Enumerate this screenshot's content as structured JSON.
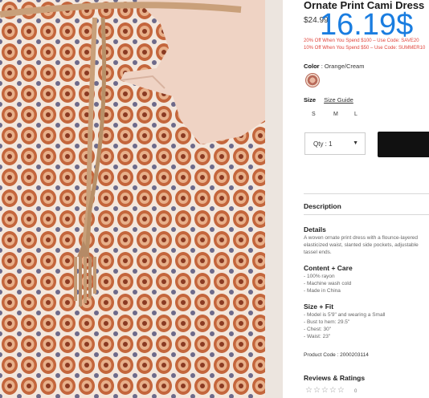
{
  "product": {
    "title": "Ornate Print Cami Dress",
    "price": "$24.99",
    "sale_price_overlay": "16.19$",
    "promo_1": "20% Off When You Spend $100 – Use Code: SAVE20",
    "promo_2": "10% Off When You Spend $50 – Use Code: SUMMER10",
    "color_label": "Color",
    "color_value": ": Orange/Cream",
    "size_label": "Size",
    "size_guide": "Size Guide",
    "sizes": [
      "S",
      "M",
      "L"
    ],
    "qty_label": "Qty : 1",
    "qty_caret": "▼",
    "description_heading": "Description",
    "details_heading": "Details",
    "details_lines": [
      "A woven ornate print dress with a flounce-layered",
      "elasticized waist, slanted side pockets, adjustable",
      "tassel ends."
    ],
    "content_heading": "Content + Care",
    "content_lines": [
      "- 100% rayon",
      "- Machine wash cold",
      "- Made in China"
    ],
    "fit_heading": "Size + Fit",
    "fit_lines": [
      "- Model is 5'9\" and wearing a Small",
      "- Bust to hem: 29.5\"",
      "- Chest: 30\"",
      "- Waist: 23\""
    ],
    "product_code": "Product Code : 2000203114",
    "reviews_heading": "Reviews & Ratings",
    "stars": "☆☆☆☆☆",
    "review_count": "0"
  },
  "colors": {
    "promo": "#e0443b",
    "overlay": "#1a7de0",
    "cart": "#111111"
  }
}
